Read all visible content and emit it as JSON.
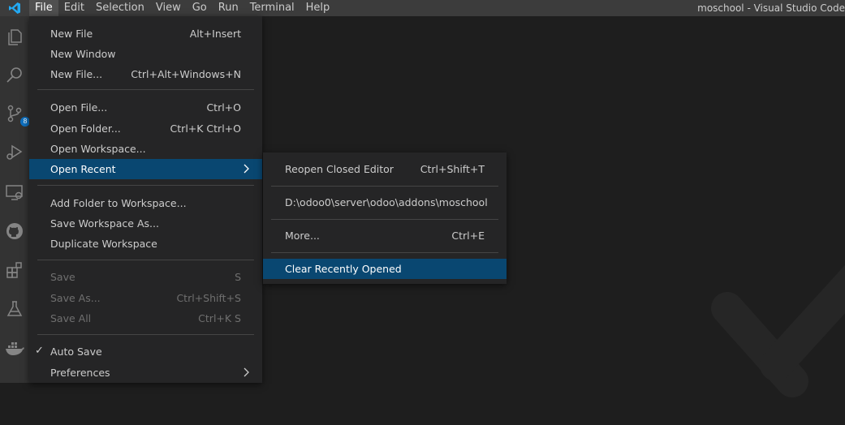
{
  "menubar": {
    "items": [
      "File",
      "Edit",
      "Selection",
      "View",
      "Go",
      "Run",
      "Terminal",
      "Help"
    ],
    "window_title": "moschool - Visual Studio Code"
  },
  "activitybar": {
    "icons": [
      "explorer-icon",
      "search-icon",
      "source-control-icon",
      "run-debug-icon",
      "remote-explorer-icon",
      "github-icon",
      "extensions-icon",
      "testing-icon",
      "docker-icon"
    ],
    "scm_badge": "8"
  },
  "file_menu": {
    "new_file": {
      "label": "New File",
      "key": "Alt+Insert"
    },
    "new_window": {
      "label": "New Window",
      "key": ""
    },
    "new_file_dots": {
      "label": "New File...",
      "key": "Ctrl+Alt+Windows+N"
    },
    "open_file": {
      "label": "Open File...",
      "key": "Ctrl+O"
    },
    "open_folder": {
      "label": "Open Folder...",
      "key": "Ctrl+K Ctrl+O"
    },
    "open_workspace": {
      "label": "Open Workspace...",
      "key": ""
    },
    "open_recent": {
      "label": "Open Recent",
      "key": ""
    },
    "add_folder": {
      "label": "Add Folder to Workspace...",
      "key": ""
    },
    "save_workspace_as": {
      "label": "Save Workspace As...",
      "key": ""
    },
    "duplicate_workspace": {
      "label": "Duplicate Workspace",
      "key": ""
    },
    "save": {
      "label": "Save",
      "key": "S"
    },
    "save_as": {
      "label": "Save As...",
      "key": "Ctrl+Shift+S"
    },
    "save_all": {
      "label": "Save All",
      "key": "Ctrl+K S"
    },
    "auto_save": {
      "label": "Auto Save",
      "key": "",
      "checked": true
    },
    "preferences": {
      "label": "Preferences",
      "key": ""
    }
  },
  "recent_menu": {
    "reopen_closed": {
      "label": "Reopen Closed Editor",
      "key": "Ctrl+Shift+T"
    },
    "recent_path": {
      "label": "D:\\odoo0\\server\\odoo\\addons\\moschool",
      "key": ""
    },
    "more": {
      "label": "More...",
      "key": "Ctrl+E"
    },
    "clear_recent": {
      "label": "Clear Recently Opened",
      "key": ""
    }
  },
  "colors": {
    "accent": "#094771",
    "badge": "#0e70c0",
    "menu_bg": "#252526",
    "titlebar_bg": "#3c3c3c",
    "activitybar_bg": "#333333",
    "editor_bg": "#1e1e1e"
  }
}
